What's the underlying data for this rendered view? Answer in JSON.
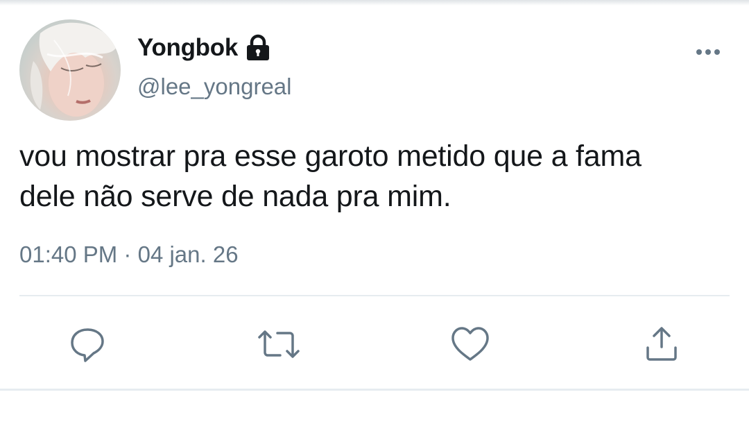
{
  "tweet": {
    "display_name": "Yongbok",
    "handle": "@lee_yongreal",
    "text_lines": [
      "vou mostrar pra esse garoto metido que a fama",
      "dele não serve de nada pra mim."
    ],
    "time": "01:40 PM",
    "separator": "·",
    "date": "04 jan. 26"
  },
  "icons": {
    "lock": "lock-icon",
    "more": "more-horizontal-icon",
    "reply": "reply-icon",
    "retweet": "retweet-icon",
    "like": "heart-icon",
    "share": "share-icon"
  },
  "colors": {
    "text_primary": "#14171a",
    "text_secondary": "#657786",
    "icon": "#657786",
    "divider": "#e6ecf0"
  }
}
